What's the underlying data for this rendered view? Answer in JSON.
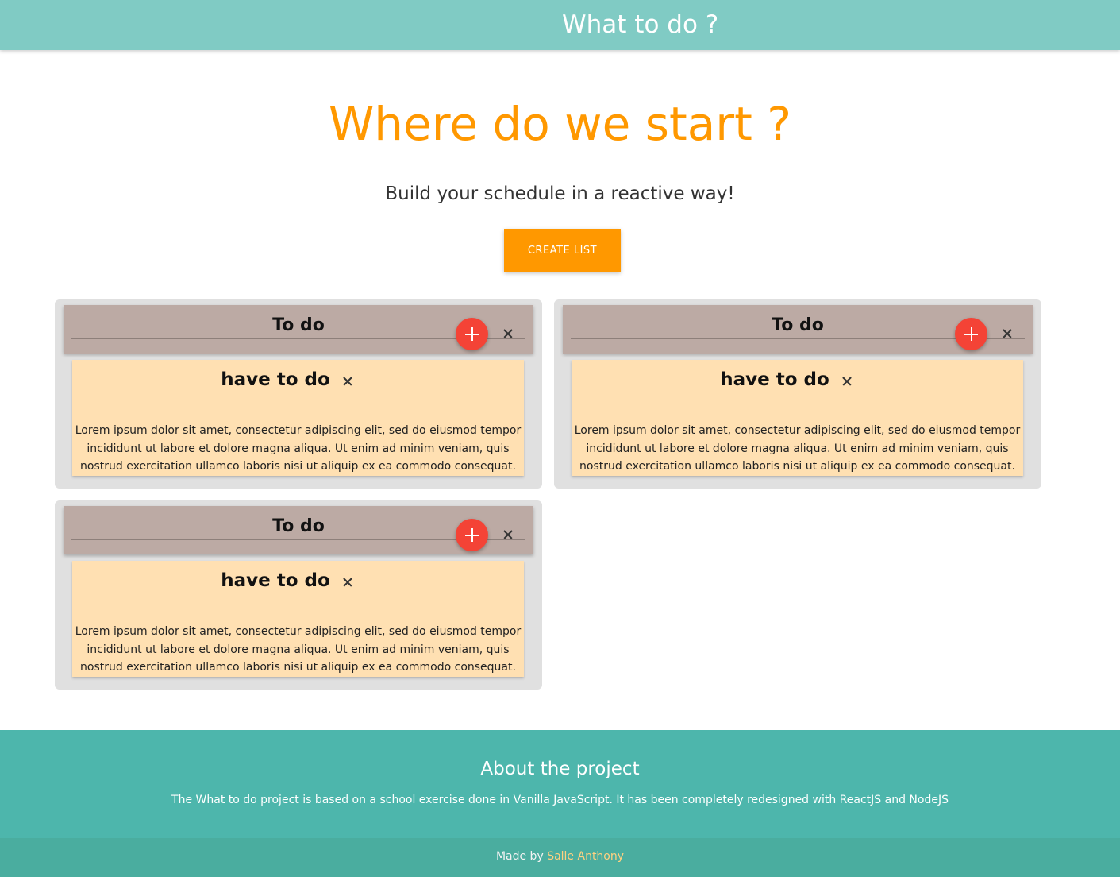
{
  "navbar": {
    "brand": "What to do ?"
  },
  "hero": {
    "title": "Where do we start ?",
    "subtitle": "Build your schedule in a reactive way!",
    "button_label": "CREATE LIST"
  },
  "lists": [
    {
      "title": "To do",
      "card": {
        "title": "have to do",
        "body": "Lorem ipsum dolor sit amet, consectetur adipiscing elit, sed do eiusmod tempor incididunt ut labore et dolore magna aliqua. Ut enim ad minim veniam, quis nostrud exercitation ullamco laboris nisi ut aliquip ex ea commodo consequat."
      }
    },
    {
      "title": "To do",
      "card": {
        "title": "have to do",
        "body": "Lorem ipsum dolor sit amet, consectetur adipiscing elit, sed do eiusmod tempor incididunt ut labore et dolore magna aliqua. Ut enim ad minim veniam, quis nostrud exercitation ullamco laboris nisi ut aliquip ex ea commodo consequat."
      }
    },
    {
      "title": "To do",
      "card": {
        "title": "have to do",
        "body": "Lorem ipsum dolor sit amet, consectetur adipiscing elit, sed do eiusmod tempor incididunt ut labore et dolore magna aliqua. Ut enim ad minim veniam, quis nostrud exercitation ullamco laboris nisi ut aliquip ex ea commodo consequat."
      }
    }
  ],
  "footer": {
    "title": "About the project",
    "text": "The What to do project is based on a school exercise done in Vanilla JavaScript. It has been completely redesigned with ReactJS and NodeJS",
    "made_by": "Made by",
    "author": "Salle Anthony"
  },
  "colors": {
    "navbar": "#80cbc4",
    "accent": "#ff9800",
    "list_bg": "#e0e0e0",
    "list_header": "#bcaaa4",
    "card_bg": "#ffe0b2",
    "add_button": "#f44336",
    "footer": "#4db6ac",
    "author_link": "#ffd180"
  },
  "icons": {
    "add": "plus-icon",
    "remove": "close-icon"
  }
}
